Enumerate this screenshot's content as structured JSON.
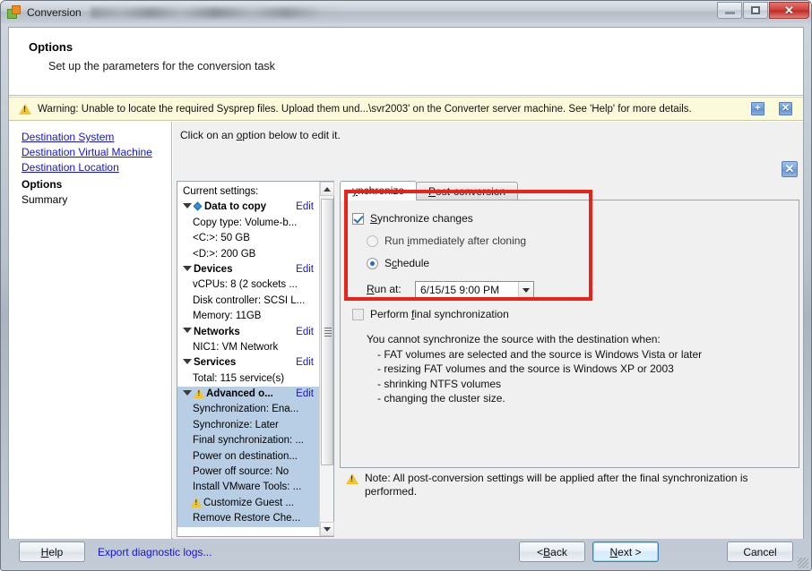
{
  "window": {
    "title": "Conversion",
    "icon": "vmware-converter-icon",
    "buttons": {
      "minimize": "minimize-icon",
      "maximize": "maximize-icon",
      "close": "✕"
    }
  },
  "header": {
    "title": "Options",
    "subtitle": "Set up the parameters for the conversion task"
  },
  "warning": {
    "icon": "warning-triangle-icon",
    "text": "Warning: Unable to locate the required Sysprep files. Upload them und...\\svr2003' on the Converter server machine. See 'Help' for more details.",
    "expand_label": "+",
    "close_label": "✕",
    "bg_color": "#fbfbdc"
  },
  "sidebar": {
    "links": [
      "Destination System",
      "Destination Virtual Machine",
      "Destination Location"
    ],
    "current": "Options",
    "plain": "Summary",
    "link_color": "#1414d2"
  },
  "content": {
    "instruction_pre": "Click on an ",
    "instruction_accel": "o",
    "instruction_post": "ption below to edit it."
  },
  "tree": {
    "header": "Current settings:",
    "edit_label": "Edit",
    "rows": [
      {
        "text": "Current settings:",
        "kind": "header"
      },
      {
        "text": "Data to copy",
        "kind": "group",
        "icon": "blue-diamond-icon",
        "edit": "Edit",
        "bold": true
      },
      {
        "text": "Copy type: Volume-b...",
        "kind": "item"
      },
      {
        "text": "<C:>: 50 GB",
        "kind": "item"
      },
      {
        "text": "<D:>: 200 GB",
        "kind": "item"
      },
      {
        "text": "Devices",
        "kind": "group",
        "edit": "Edit",
        "bold": true
      },
      {
        "text": "vCPUs: 8 (2 sockets ...",
        "kind": "item"
      },
      {
        "text": "Disk controller: SCSI L...",
        "kind": "item"
      },
      {
        "text": "Memory: 11GB",
        "kind": "item"
      },
      {
        "text": "Networks",
        "kind": "group",
        "edit": "Edit",
        "bold": true
      },
      {
        "text": "NIC1: VM Network",
        "kind": "item"
      },
      {
        "text": "Services",
        "kind": "group",
        "edit": "Edit",
        "bold": true
      },
      {
        "text": "Total: 115 service(s)",
        "kind": "item"
      },
      {
        "text": "Advanced o...",
        "kind": "group",
        "icon": "warning-triangle-icon",
        "edit": "Edit",
        "bold": true,
        "selected": true
      },
      {
        "text": "Synchronization: Ena...",
        "kind": "item",
        "selected": true
      },
      {
        "text": "Synchronize: Later",
        "kind": "item",
        "selected": true
      },
      {
        "text": "Final synchronization: ...",
        "kind": "item",
        "selected": true
      },
      {
        "text": "Power on destination...",
        "kind": "item",
        "selected": true
      },
      {
        "text": "Power off source: No",
        "kind": "item",
        "selected": true
      },
      {
        "text": "Install VMware Tools: ...",
        "kind": "item",
        "selected": true
      },
      {
        "text": "Customize Guest ...",
        "kind": "item",
        "icon": "warning-triangle-icon",
        "selected": true
      },
      {
        "text": "Remove Restore Che...",
        "kind": "item",
        "selected": true
      }
    ],
    "selection_color": "#b8cee4"
  },
  "options_panel": {
    "close_label": "✕",
    "tabs": [
      {
        "label": "Synchronize",
        "accel": "y",
        "active": true
      },
      {
        "label": "Post-conversion",
        "accel": "P",
        "active": false
      }
    ],
    "highlight_color": "#e8241a",
    "sync_changes": {
      "label": "Synchronize changes",
      "accel": "S",
      "checked": true
    },
    "radios": [
      {
        "label": "Run immediately after cloning",
        "accel": "i",
        "selected": false
      },
      {
        "label": "Schedule",
        "accel": "c",
        "selected": true
      }
    ],
    "run_at": {
      "label": "Run at:",
      "accel": "R",
      "value": "6/15/15 9:00 PM"
    },
    "final_sync": {
      "label": "Perform final synchronization",
      "accel": "f",
      "checked": false,
      "enabled": false
    },
    "cannot_sync": {
      "intro": "You cannot synchronize the source with the destination when:",
      "bullets": [
        "- FAT volumes are selected and the source is Windows Vista or later",
        "- resizing FAT volumes and the source is Windows XP or 2003",
        "- shrinking NTFS volumes",
        "- changing the cluster size."
      ]
    },
    "note": {
      "icon": "warning-triangle-icon",
      "text": "Note: All post-conversion settings will be applied after the final synchronization is performed."
    }
  },
  "footer": {
    "help": "Help",
    "help_accel": "H",
    "export_link": "Export diagnostic logs...",
    "back": "< Back",
    "back_accel": "B",
    "next": "Next >",
    "next_accel": "N",
    "cancel": "Cancel"
  }
}
